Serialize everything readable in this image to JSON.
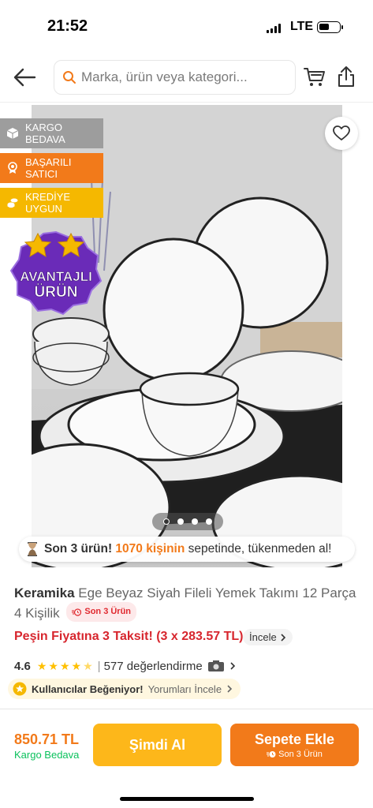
{
  "status_bar": {
    "time": "21:52",
    "network": "LTE"
  },
  "nav": {
    "search_placeholder": "Marka, ürün veya kategori..."
  },
  "badges": {
    "cargo": "KARGO BEDAVA",
    "seller": "BAŞARILI SATICI",
    "credit": "KREDİYE UYGUN",
    "advantage_line1": "AVANTAJLI",
    "advantage_line2": "ÜRÜN"
  },
  "gallery": {
    "total_images": 4,
    "active_index": 0
  },
  "urgency": {
    "prefix": "Son 3 ürün!",
    "highlight": "1070 kişinin",
    "suffix": "sepetinde, tükenmeden al!"
  },
  "product": {
    "brand": "Keramika",
    "name": "Ege Beyaz Siyah Fileli Yemek Takımı 12 Parça 4 Kişilik",
    "stock_chip": "Son 3 Ürün"
  },
  "installment": {
    "text": "Peşin Fiyatına 3 Taksit! (3 x 283.57 TL)",
    "link": "İncele"
  },
  "rating": {
    "score": "4.6",
    "stars": 4.6,
    "separator": "|",
    "reviews": "577 değerlendirme"
  },
  "liked": {
    "label": "Kullanıcılar Beğeniyor!",
    "link": "Yorumları İncele"
  },
  "bottom": {
    "price": "850.71 TL",
    "shipping": "Kargo Bedava",
    "buy_now": "Şimdi Al",
    "add_to_cart": "Sepete Ekle",
    "add_to_cart_sub": "Son 3 Ürün"
  },
  "colors": {
    "accent": "#f27a1a",
    "buy_now": "#fdb71a",
    "stock_red": "#e0292f",
    "free_shipping": "#0bc15c",
    "advantage_purple": "#6a2bb8"
  }
}
